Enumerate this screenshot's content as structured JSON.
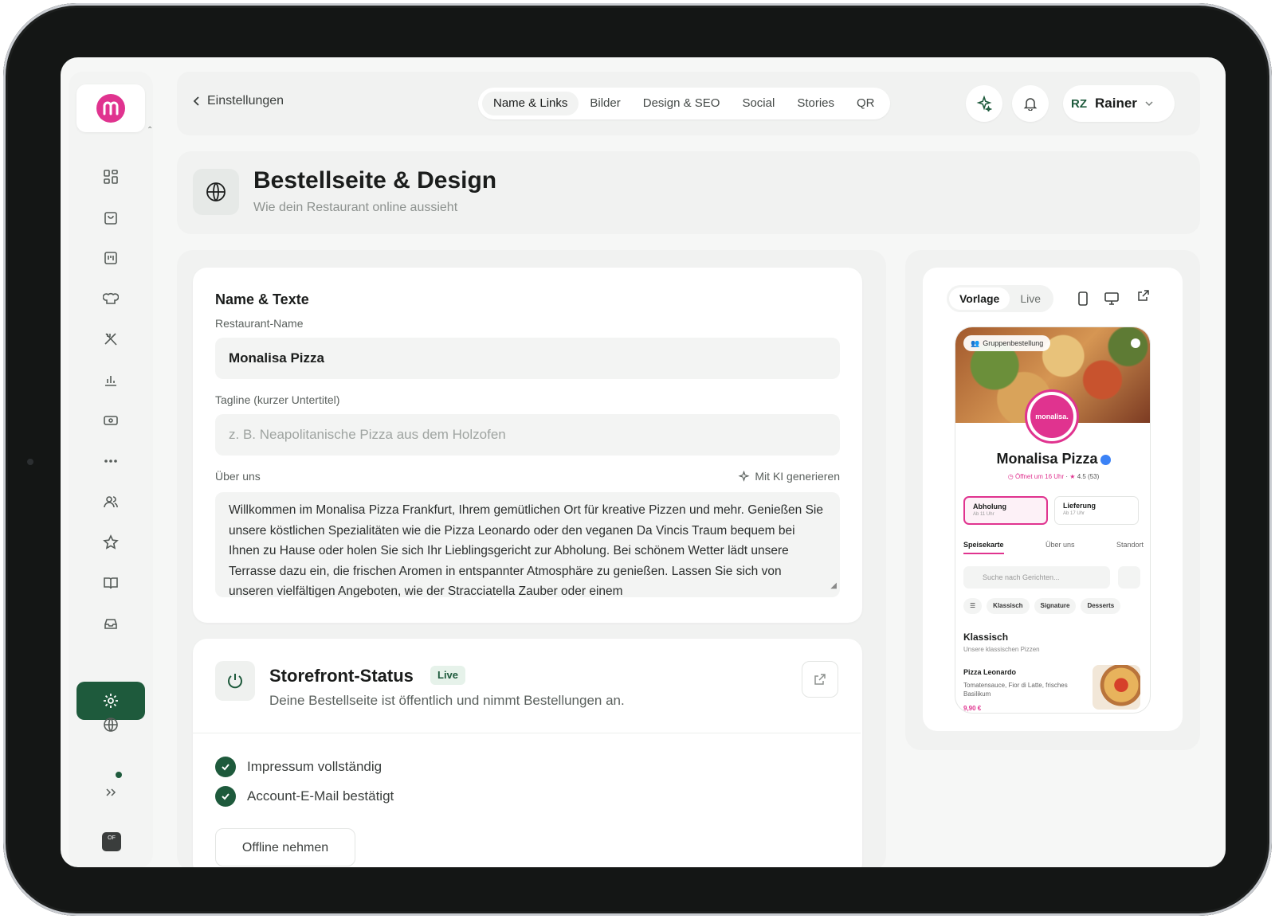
{
  "header": {
    "back_label": "Einstellungen",
    "tabs": [
      {
        "label": "Name & Links",
        "active": true
      },
      {
        "label": "Bilder"
      },
      {
        "label": "Design & SEO"
      },
      {
        "label": "Social"
      },
      {
        "label": "Stories"
      },
      {
        "label": "QR"
      }
    ],
    "user": {
      "initials": "RZ",
      "name": "Rainer"
    }
  },
  "page": {
    "title": "Bestellseite & Design",
    "subtitle": "Wie dein Restaurant online aussieht"
  },
  "name_texts": {
    "title": "Name & Texte",
    "restaurant_name_label": "Restaurant-Name",
    "restaurant_name_value": "Monalisa Pizza",
    "tagline_label": "Tagline (kurzer Untertitel)",
    "tagline_placeholder": "z. B. Neapolitanische Pizza aus dem Holzofen",
    "about_label": "Über uns",
    "ai_label": "Mit KI generieren",
    "about_text": "Willkommen im Monalisa Pizza Frankfurt, Ihrem gemütlichen Ort für kreative Pizzen und mehr. Genießen Sie unsere köstlichen Spezialitäten wie die Pizza Leonardo oder den veganen Da Vincis Traum bequem bei Ihnen zu Hause oder holen Sie sich Ihr Lieblingsgericht zur Abholung. Bei schönem Wetter lädt unsere Terrasse dazu ein, die frischen Aromen in entspannter Atmosphäre zu genießen. Lassen Sie sich von unseren vielfältigen Angeboten, wie der Stracciatella Zauber oder einem"
  },
  "status": {
    "title": "Storefront-Status",
    "badge": "Live",
    "description": "Deine Bestellseite ist öffentlich und nimmt Bestellungen an.",
    "checks": [
      "Impressum vollständig",
      "Account-E-Mail bestätigt"
    ],
    "offline_button": "Offline nehmen"
  },
  "preview": {
    "mode_tabs": [
      {
        "label": "Vorlage",
        "active": true
      },
      {
        "label": "Live"
      }
    ],
    "group_order_badge": "Gruppenbestellung",
    "logo_text": "monalisa.",
    "restaurant_name": "Monalisa Pizza",
    "opening": "Öffnet um 16 Uhr",
    "rating": "4.5 (53)",
    "modes": [
      {
        "label": "Abholung",
        "sub": "Ab 11 Uhr",
        "active": true
      },
      {
        "label": "Lieferung",
        "sub": "Ab 17 Uhr"
      }
    ],
    "tabs": [
      {
        "label": "Speisekarte",
        "active": true
      },
      {
        "label": "Über uns"
      },
      {
        "label": "Standort"
      }
    ],
    "search_placeholder": "Suche nach Gerichten...",
    "chips": [
      "Klassisch",
      "Signature",
      "Desserts"
    ],
    "category": "Klassisch",
    "category_sub": "Unsere klassischen Pizzen",
    "item": {
      "name": "Pizza Leonardo",
      "description": "Tomatensauce, Fior di Latte, frisches Basilikum",
      "price": "9,90 €"
    }
  },
  "colors": {
    "accent": "#1e5a3c",
    "brand": "#e0338f"
  }
}
